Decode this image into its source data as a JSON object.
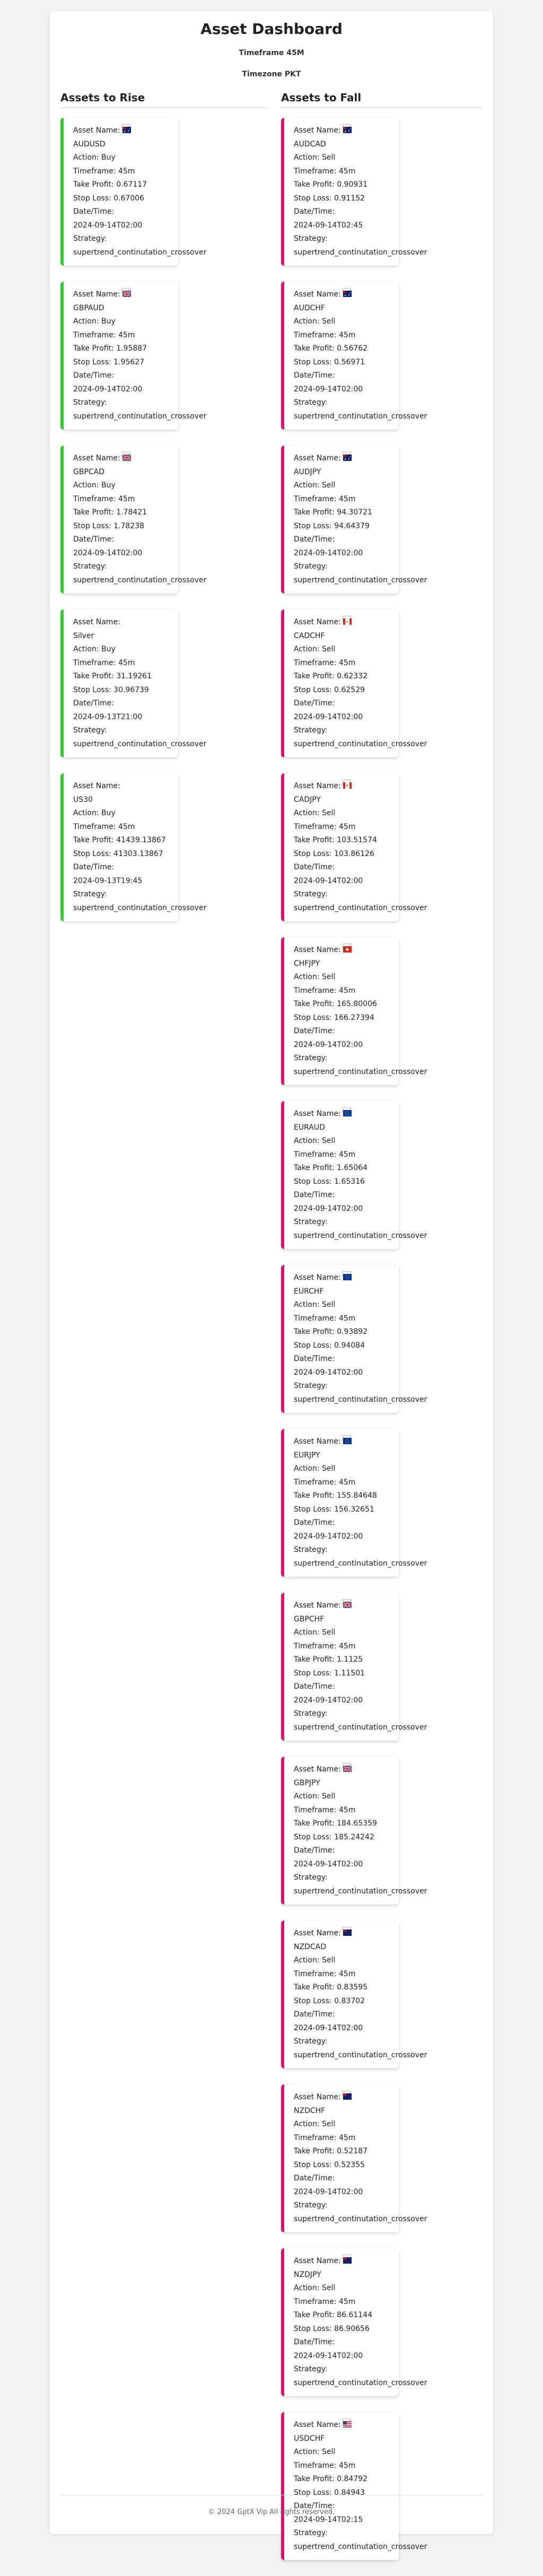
{
  "header": {
    "title": "Asset Dashboard",
    "timeframe": "Timeframe 45M",
    "timezone": "Timezone PKT"
  },
  "sections": {
    "rise_title": "Assets to Rise",
    "fall_title": "Assets to Fall"
  },
  "labels": {
    "asset_name": "Asset Name:",
    "action": "Action:",
    "timeframe": "Timeframe:",
    "take_profit": "Take Profit:",
    "stop_loss": "Stop Loss:",
    "datetime": "Date/Time:",
    "strategy": "Strategy:"
  },
  "colors": {
    "rise_border": "#33cc33",
    "fall_border": "#dd1177"
  },
  "assets_rise": [
    {
      "flag": "au-flag-icon",
      "name": "AUDUSD",
      "action": "Buy",
      "timeframe": "45m",
      "take_profit": "0.67117",
      "stop_loss": "0.67006",
      "datetime": "2024-09-14T02:00",
      "strategy": "supertrend_continutation_crossover"
    },
    {
      "flag": "gb-flag-icon",
      "name": "GBPAUD",
      "action": "Buy",
      "timeframe": "45m",
      "take_profit": "1.95887",
      "stop_loss": "1.95627",
      "datetime": "2024-09-14T02:00",
      "strategy": "supertrend_continutation_crossover"
    },
    {
      "flag": "gb-flag-icon",
      "name": "GBPCAD",
      "action": "Buy",
      "timeframe": "45m",
      "take_profit": "1.78421",
      "stop_loss": "1.78238",
      "datetime": "2024-09-14T02:00",
      "strategy": "supertrend_continutation_crossover"
    },
    {
      "flag": "",
      "name": "Silver",
      "action": "Buy",
      "timeframe": "45m",
      "take_profit": "31.19261",
      "stop_loss": "30.96739",
      "datetime": "2024-09-13T21:00",
      "strategy": "supertrend_continutation_crossover"
    },
    {
      "flag": "",
      "name": "US30",
      "action": "Buy",
      "timeframe": "45m",
      "take_profit": "41439.13867",
      "stop_loss": "41303.13867",
      "datetime": "2024-09-13T19:45",
      "strategy": "supertrend_continutation_crossover"
    }
  ],
  "assets_fall": [
    {
      "flag": "au-flag-icon",
      "name": "AUDCAD",
      "action": "Sell",
      "timeframe": "45m",
      "take_profit": "0.90931",
      "stop_loss": "0.91152",
      "datetime": "2024-09-14T02:45",
      "strategy": "supertrend_continutation_crossover"
    },
    {
      "flag": "au-flag-icon",
      "name": "AUDCHF",
      "action": "Sell",
      "timeframe": "45m",
      "take_profit": "0.56762",
      "stop_loss": "0.56971",
      "datetime": "2024-09-14T02:00",
      "strategy": "supertrend_continutation_crossover"
    },
    {
      "flag": "au-flag-icon",
      "name": "AUDJPY",
      "action": "Sell",
      "timeframe": "45m",
      "take_profit": "94.30721",
      "stop_loss": "94.64379",
      "datetime": "2024-09-14T02:00",
      "strategy": "supertrend_continutation_crossover"
    },
    {
      "flag": "ca-flag-icon",
      "name": "CADCHF",
      "action": "Sell",
      "timeframe": "45m",
      "take_profit": "0.62332",
      "stop_loss": "0.62529",
      "datetime": "2024-09-14T02:00",
      "strategy": "supertrend_continutation_crossover"
    },
    {
      "flag": "ca-flag-icon",
      "name": "CADJPY",
      "action": "Sell",
      "timeframe": "45m",
      "take_profit": "103.51574",
      "stop_loss": "103.86126",
      "datetime": "2024-09-14T02:00",
      "strategy": "supertrend_continutation_crossover"
    },
    {
      "flag": "ch-flag-icon",
      "name": "CHFJPY",
      "action": "Sell",
      "timeframe": "45m",
      "take_profit": "165.80006",
      "stop_loss": "166.27394",
      "datetime": "2024-09-14T02:00",
      "strategy": "supertrend_continutation_crossover"
    },
    {
      "flag": "eu-flag-icon",
      "name": "EURAUD",
      "action": "Sell",
      "timeframe": "45m",
      "take_profit": "1.65064",
      "stop_loss": "1.65316",
      "datetime": "2024-09-14T02:00",
      "strategy": "supertrend_continutation_crossover"
    },
    {
      "flag": "eu-flag-icon",
      "name": "EURCHF",
      "action": "Sell",
      "timeframe": "45m",
      "take_profit": "0.93892",
      "stop_loss": "0.94084",
      "datetime": "2024-09-14T02:00",
      "strategy": "supertrend_continutation_crossover"
    },
    {
      "flag": "eu-flag-icon",
      "name": "EURJPY",
      "action": "Sell",
      "timeframe": "45m",
      "take_profit": "155.84648",
      "stop_loss": "156.32651",
      "datetime": "2024-09-14T02:00",
      "strategy": "supertrend_continutation_crossover"
    },
    {
      "flag": "gb-flag-icon",
      "name": "GBPCHF",
      "action": "Sell",
      "timeframe": "45m",
      "take_profit": "1.1125",
      "stop_loss": "1.11501",
      "datetime": "2024-09-14T02:00",
      "strategy": "supertrend_continutation_crossover"
    },
    {
      "flag": "gb-flag-icon",
      "name": "GBPJPY",
      "action": "Sell",
      "timeframe": "45m",
      "take_profit": "184.65359",
      "stop_loss": "185.24242",
      "datetime": "2024-09-14T02:00",
      "strategy": "supertrend_continutation_crossover"
    },
    {
      "flag": "nz-flag-icon",
      "name": "NZDCAD",
      "action": "Sell",
      "timeframe": "45m",
      "take_profit": "0.83595",
      "stop_loss": "0.83702",
      "datetime": "2024-09-14T02:00",
      "strategy": "supertrend_continutation_crossover"
    },
    {
      "flag": "nz-flag-icon",
      "name": "NZDCHF",
      "action": "Sell",
      "timeframe": "45m",
      "take_profit": "0.52187",
      "stop_loss": "0.52355",
      "datetime": "2024-09-14T02:00",
      "strategy": "supertrend_continutation_crossover"
    },
    {
      "flag": "nz-flag-icon",
      "name": "NZDJPY",
      "action": "Sell",
      "timeframe": "45m",
      "take_profit": "86.61144",
      "stop_loss": "86.90656",
      "datetime": "2024-09-14T02:00",
      "strategy": "supertrend_continutation_crossover"
    },
    {
      "flag": "us-flag-icon",
      "name": "USDCHF",
      "action": "Sell",
      "timeframe": "45m",
      "take_profit": "0.84792",
      "stop_loss": "0.84943",
      "datetime": "2024-09-14T02:15",
      "strategy": "supertrend_continutation_crossover"
    }
  ],
  "footer": {
    "text": "© 2024 GptX Vip All rights reserved."
  }
}
